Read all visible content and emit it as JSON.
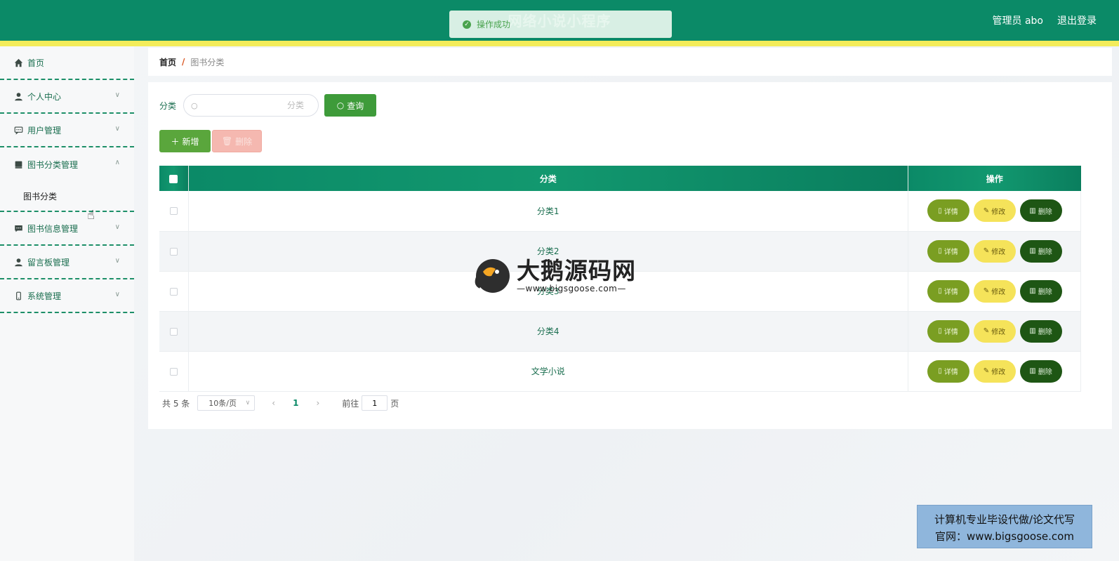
{
  "header": {
    "app_title": "网络小说小程序",
    "user": "管理员 abo",
    "logout": "退出登录",
    "toast": "操作成功"
  },
  "sidebar": {
    "items": [
      {
        "label": "首页",
        "icon": "home-icon",
        "has_chevron": false
      },
      {
        "label": "个人中心",
        "icon": "user-icon",
        "has_chevron": true
      },
      {
        "label": "用户管理",
        "icon": "chat-icon",
        "has_chevron": true
      },
      {
        "label": "图书分类管理",
        "icon": "book-icon",
        "has_chevron": true,
        "expanded": true,
        "children": [
          "图书分类"
        ]
      },
      {
        "label": "图书信息管理",
        "icon": "message-icon",
        "has_chevron": true
      },
      {
        "label": "留言板管理",
        "icon": "user-icon",
        "has_chevron": true
      },
      {
        "label": "系统管理",
        "icon": "phone-icon",
        "has_chevron": true
      }
    ],
    "sub_label": "图书分类"
  },
  "breadcrumb": {
    "home": "首页",
    "separator": "/",
    "current": "图书分类"
  },
  "search": {
    "label": "分类",
    "placeholder": "分类",
    "query_button": "查询"
  },
  "actions": {
    "add": "新增",
    "delete": "删除"
  },
  "table": {
    "columns": [
      "分类",
      "操作"
    ],
    "rows": [
      {
        "category": "分类1"
      },
      {
        "category": "分类2"
      },
      {
        "category": "分类3"
      },
      {
        "category": "分类4"
      },
      {
        "category": "文学小说"
      }
    ],
    "op_labels": {
      "detail": "详情",
      "edit": "修改",
      "delete": "删除"
    }
  },
  "pagination": {
    "total": "共 5 条",
    "page_size": "10条/页",
    "current_page": "1",
    "goto_prefix": "前往",
    "goto_value": "1",
    "goto_suffix": "页"
  },
  "watermark": {
    "title": "大鹅源码网",
    "url": "—www.bigsgoose.com—"
  },
  "corner_ad": {
    "line1": "计算机专业毕设代做/论文代写",
    "line2": "官网：www.bigsgoose.com"
  },
  "colors": {
    "primary": "#0b8a67",
    "stripe": "#f3ec5a",
    "detail": "#7a9e22",
    "edit": "#f5e35a",
    "delete": "#1e5614"
  }
}
